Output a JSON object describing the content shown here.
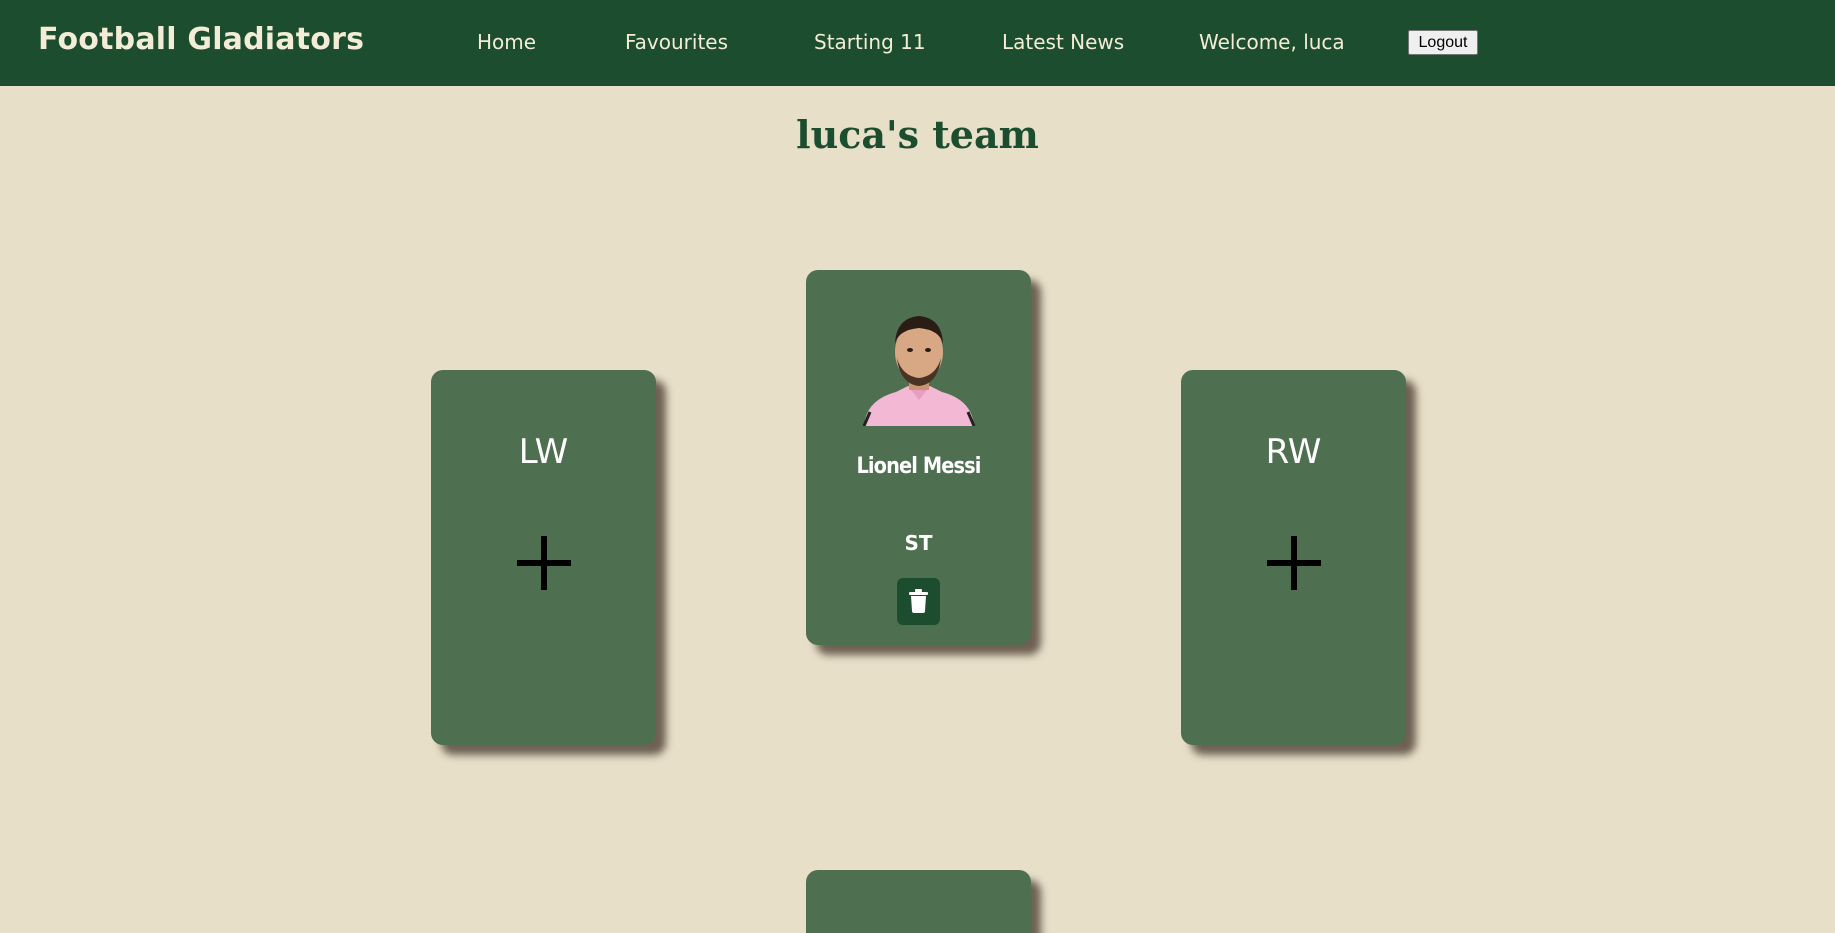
{
  "navbar": {
    "brand": "Football Gladiators",
    "links": [
      "Home",
      "Favourites",
      "Starting 11",
      "Latest News"
    ],
    "welcome": "Welcome, luca",
    "logout_label": "Logout"
  },
  "page": {
    "title": "luca's team"
  },
  "cards": {
    "lw": {
      "position": "LW"
    },
    "st": {
      "player_name": "Lionel Messi",
      "position": "ST"
    },
    "rw": {
      "position": "RW"
    }
  },
  "icons": {
    "add": "plus-icon",
    "delete": "trash-icon"
  },
  "colors": {
    "nav_bg": "#1b4d2e",
    "page_bg": "#e7dfc8",
    "card_bg": "#4e6f50",
    "accent": "#1b4d2e"
  }
}
